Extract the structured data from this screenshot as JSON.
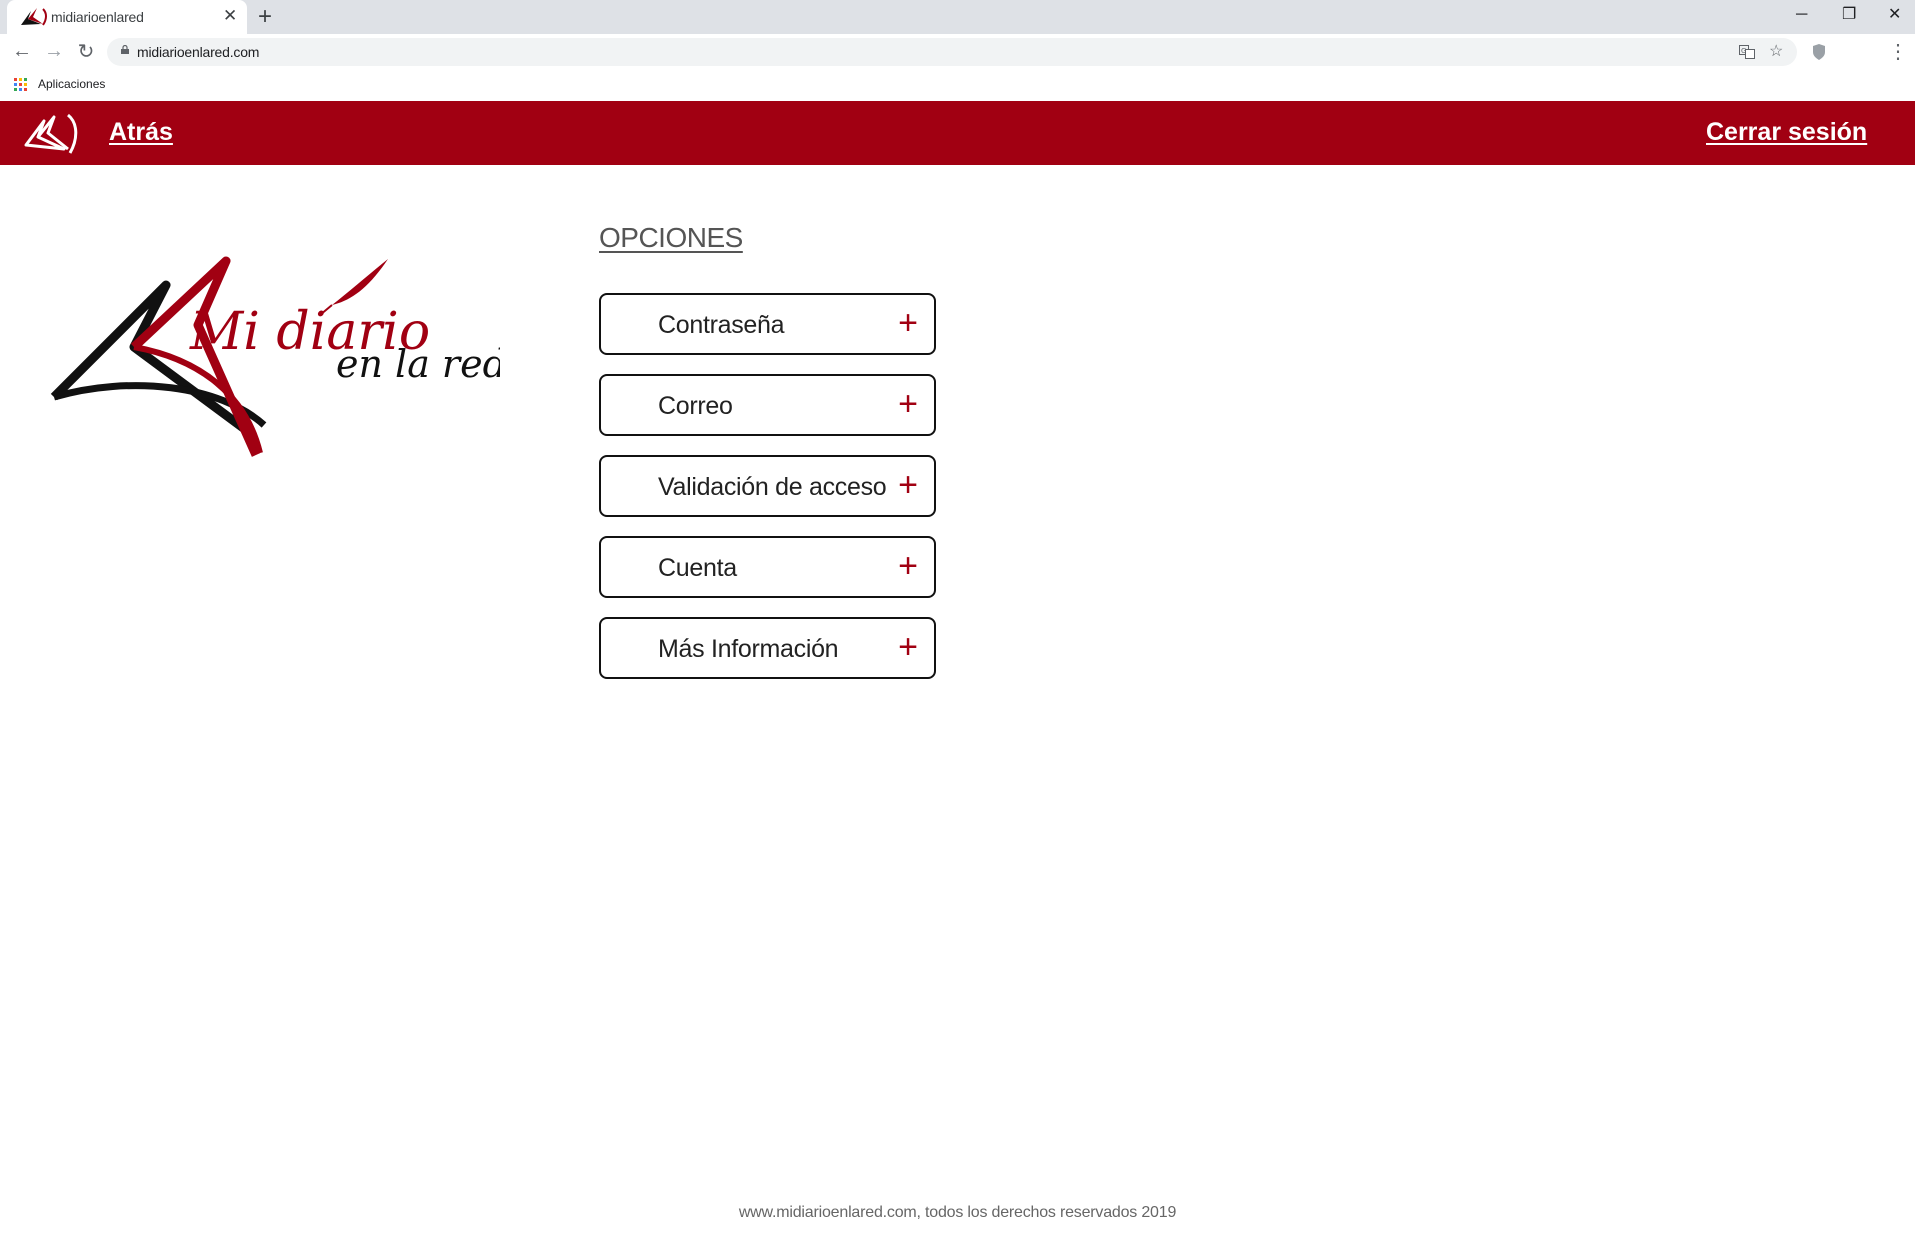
{
  "browser": {
    "tab_title": "midiarioenlared",
    "tab_close": "✕",
    "new_tab": "+",
    "url": "midiarioenlared.com",
    "bookmarks_label": "Aplicaciones",
    "window_controls": {
      "minimize": "─",
      "restore": "❐",
      "close": "✕"
    },
    "nav": {
      "back": "←",
      "forward": "→",
      "reload": "↻",
      "menu": "⋮",
      "star": "☆"
    }
  },
  "header": {
    "back_label": "Atrás",
    "logout_label": "Cerrar sesión",
    "background_color": "#a10012"
  },
  "logo": {
    "line1": "Mi diario",
    "line2": "en la red..."
  },
  "options": {
    "title": "OPCIONES",
    "items": [
      {
        "label": "Contraseña",
        "icon": "+"
      },
      {
        "label": "Correo",
        "icon": "+"
      },
      {
        "label": "Validación de acceso",
        "icon": "+"
      },
      {
        "label": "Cuenta",
        "icon": "+"
      },
      {
        "label": "Más Información",
        "icon": "+"
      }
    ]
  },
  "footer": {
    "text": "www.midiarioenlared.com, todos los derechos reservados 2019"
  },
  "colors": {
    "accent": "#a10012",
    "text": "#222222"
  },
  "icons": [
    "site-logo-icon",
    "plus-icon",
    "lock-icon",
    "apps-grid-icon",
    "translate-icon",
    "star-icon",
    "shield-extension-icon"
  ]
}
